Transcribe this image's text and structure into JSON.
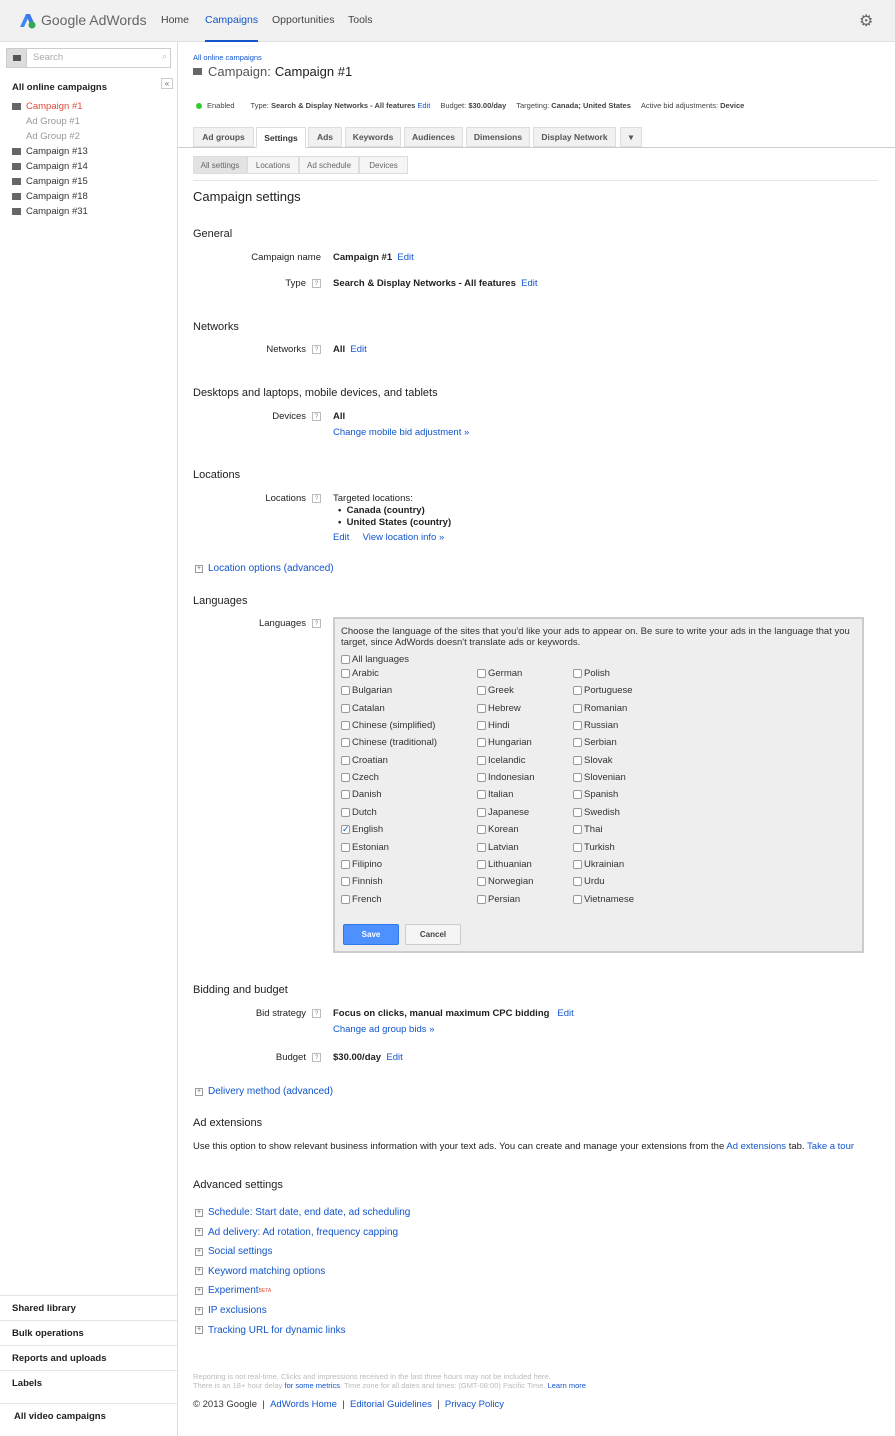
{
  "header": {
    "logo": "Google AdWords",
    "nav": [
      "Home",
      "Campaigns",
      "Opportunities",
      "Tools"
    ],
    "active_nav": "Campaigns",
    "settings_icon": "gear-icon"
  },
  "sidebar": {
    "search_placeholder": "Search",
    "title": "All online campaigns",
    "items": [
      {
        "label": "Campaign #1",
        "active": true
      },
      {
        "label": "Ad Group #1",
        "sub": true
      },
      {
        "label": "Ad Group #2",
        "sub": true
      },
      {
        "label": "Campaign #13"
      },
      {
        "label": "Campaign #14"
      },
      {
        "label": "Campaign #15"
      },
      {
        "label": "Campaign #18"
      },
      {
        "label": "Campaign #31"
      }
    ],
    "bottom": [
      "Shared library",
      "Bulk operations",
      "Reports and uploads",
      "Labels",
      "All video campaigns"
    ]
  },
  "main": {
    "breadcrumb": "All online campaigns",
    "title_prefix": "Campaign:",
    "title": "Campaign #1",
    "status": {
      "enabled": "Enabled",
      "type_label": "Type:",
      "type": "Search & Display Networks - All features",
      "edit": "Edit",
      "budget_label": "Budget:",
      "budget": "$30.00/day",
      "targeting_label": "Targeting:",
      "targeting": "Canada; United States",
      "bid_label": "Active bid adjustments:",
      "bid": "Device"
    },
    "tabs": [
      "Ad groups",
      "Settings",
      "Ads",
      "Keywords",
      "Audiences",
      "Dimensions",
      "Display Network"
    ],
    "active_tab": "Settings",
    "subtabs": [
      "All settings",
      "Locations",
      "Ad schedule",
      "Devices"
    ],
    "active_subtab": "All settings",
    "heading": "Campaign settings",
    "general": {
      "title": "General",
      "name_label": "Campaign name",
      "name": "Campaign #1",
      "type_label": "Type",
      "type": "Search & Display Networks - All features",
      "edit": "Edit"
    },
    "networks": {
      "title": "Networks",
      "label": "Networks",
      "value": "All",
      "edit": "Edit"
    },
    "devices": {
      "title": "Desktops and laptops, mobile devices, and tablets",
      "label": "Devices",
      "value": "All",
      "link": "Change mobile bid adjustment »"
    },
    "locations": {
      "title": "Locations",
      "label": "Locations",
      "intro": "Targeted locations:",
      "list": [
        "Canada (country)",
        "United States (country)"
      ],
      "edit": "Edit",
      "view": "View location info »",
      "options": "Location options (advanced)"
    },
    "languages": {
      "title": "Languages",
      "label": "Languages",
      "intro": "Choose the language of the sites that you'd like your ads to appear on. Be sure to write your ads in the language that you target, since AdWords doesn't translate ads or keywords.",
      "all": "All languages",
      "columns": [
        [
          "Arabic",
          "Bulgarian",
          "Catalan",
          "Chinese (simplified)",
          "Chinese (traditional)",
          "Croatian",
          "Czech",
          "Danish",
          "Dutch",
          "English",
          "Estonian",
          "Filipino",
          "Finnish",
          "French"
        ],
        [
          "German",
          "Greek",
          "Hebrew",
          "Hindi",
          "Hungarian",
          "Icelandic",
          "Indonesian",
          "Italian",
          "Japanese",
          "Korean",
          "Latvian",
          "Lithuanian",
          "Norwegian",
          "Persian"
        ],
        [
          "Polish",
          "Portuguese",
          "Romanian",
          "Russian",
          "Serbian",
          "Slovak",
          "Slovenian",
          "Spanish",
          "Swedish",
          "Thai",
          "Turkish",
          "Ukrainian",
          "Urdu",
          "Vietnamese"
        ]
      ],
      "checked": [
        "English"
      ],
      "save": "Save",
      "cancel": "Cancel"
    },
    "bidding": {
      "title": "Bidding and budget",
      "strategy_label": "Bid strategy",
      "strategy": "Focus on clicks, manual maximum CPC bidding",
      "edit": "Edit",
      "change": "Change ad group bids »",
      "budget_label": "Budget",
      "budget": "$30.00/day",
      "delivery": "Delivery method (advanced)"
    },
    "ad_extensions": {
      "title": "Ad extensions",
      "text": "Use this option to show relevant business information with your text ads. You can create and manage your extensions from the",
      "link": "Ad extensions",
      "text2": "tab.",
      "tour": "Take a tour"
    },
    "advanced": {
      "title": "Advanced settings",
      "items": [
        "Schedule: Start date, end date, ad scheduling",
        "Ad delivery: Ad rotation, frequency capping",
        "Social settings",
        "Keyword matching options",
        "Experiment",
        "IP exclusions",
        "Tracking URL for dynamic links"
      ],
      "beta": "BETA"
    },
    "footer": {
      "line1": "Reporting is not real-time. Clicks and impressions received in the last three hours may not be included here.",
      "line2a": "There is an 18+ hour delay",
      "line2link": "for some metrics",
      "line2b": ". Time zone for all dates and times: (GMT-08:00) Pacific Time.",
      "learn": "Learn more",
      "copyright": "© 2013 Google",
      "links": [
        "AdWords Home",
        "Editorial Guidelines",
        "Privacy Policy"
      ]
    }
  },
  "colors": {
    "accent": "#1155cc",
    "active_campaign": "#dd4b39",
    "save_button": "#4d90fe",
    "enabled_dot": "#3c3"
  }
}
